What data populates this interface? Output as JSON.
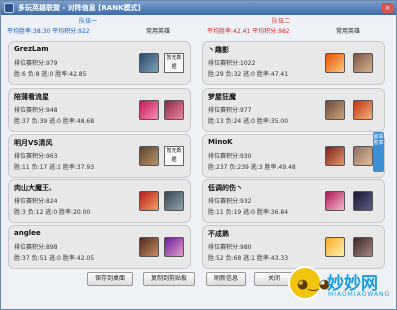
{
  "window": {
    "title": "多玩英雄联盟 - 对阵信息 [RANK模式]",
    "close_label": "×"
  },
  "team1": {
    "name": "队伍一",
    "stats": "平均胜率:38.30 平均积分:922",
    "common_label": "常用英雄"
  },
  "team2": {
    "name": "队伍二",
    "stats": "平均胜率:42.41 平均积分:982",
    "common_label": "常用英雄"
  },
  "players_left": [
    {
      "name": "GrezLam",
      "score": "排位赛积分:979",
      "record": "胜:6 负:8 逃:0 胜率:42.85",
      "no_data": "暂无数据"
    },
    {
      "name": "陪蒲看流星",
      "score": "排位赛积分:948",
      "record": "胜:37 负:39 逃:0 胜率:48.68",
      "no_data": ""
    },
    {
      "name": "明月VS清风",
      "score": "排位赛积分:963",
      "record": "胜:11 负:17 逃:1 胜率:37.93",
      "no_data": "暂无数据"
    },
    {
      "name": "肉山大魔王、",
      "score": "排位赛积分:824",
      "record": "胜:3 负:12 逃:0 胜率:20.00",
      "no_data": ""
    },
    {
      "name": "anglee",
      "score": "排位赛积分:898",
      "record": "胜:37 负:51 逃:0 胜率:42.05",
      "no_data": ""
    }
  ],
  "players_right": [
    {
      "name": "丶趣影",
      "score": "排位赛积分:1022",
      "record": "胜:29 负:32 逃:0 胜率:47.41"
    },
    {
      "name": "梦屋狂魔",
      "score": "排位赛积分:977",
      "record": "胜:13 负:24 逃:0 胜率:35.00"
    },
    {
      "name": "MinoK",
      "score": "排位赛积分:930",
      "record": "胜:237 负:239 逃:3 胜率:49.48"
    },
    {
      "name": "低调的伤丶",
      "score": "排位赛积分:932",
      "record": "胜:11 负:19 逃:0 胜率:36.84"
    },
    {
      "name": "不成熟",
      "score": "排位赛积分:980",
      "record": "胜:52 负:68 逃:1 胜率:43.33"
    }
  ],
  "side_tag": "最高胜率",
  "buttons": {
    "save": "保存到桌面",
    "copy": "复制到剪贴板",
    "refresh": "刷新信息",
    "close": "关闭"
  },
  "watermark": {
    "text": "妙妙网",
    "sub": "MIAOMIAOWANG"
  },
  "colors": {
    "team1": "#1a5bc4",
    "team2": "#d22a2a",
    "titlebar": "#3f6aa8"
  }
}
